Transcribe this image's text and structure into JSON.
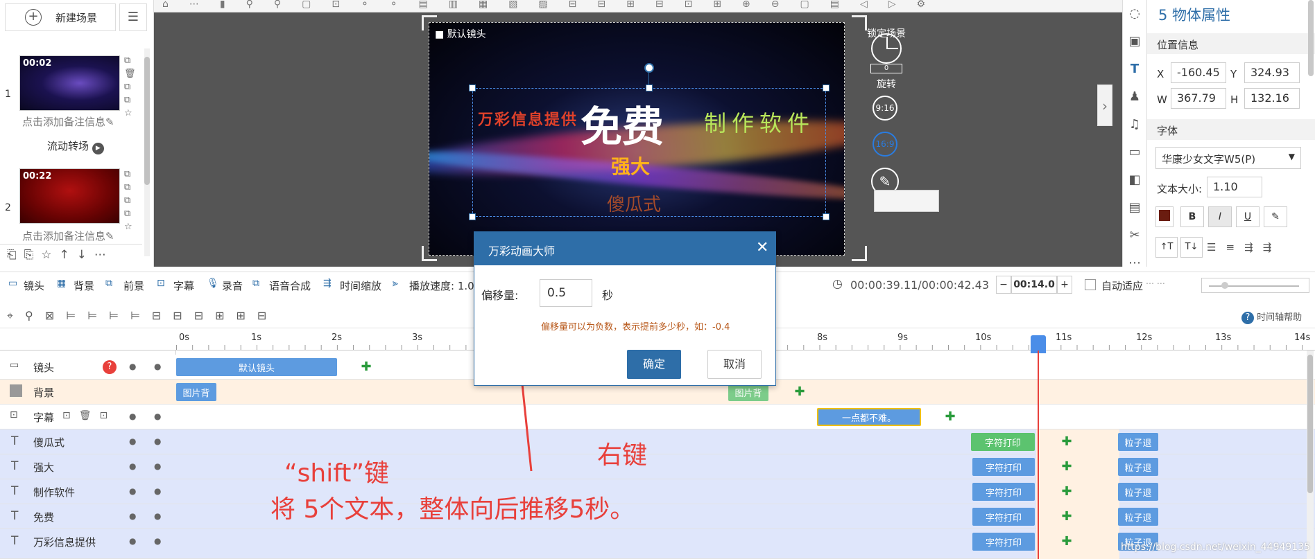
{
  "left_panel": {
    "new_scene_label": "新建场景",
    "scenes": [
      {
        "index": "1",
        "time": "00:02",
        "note": "点击添加备注信息",
        "transition": "流动转场"
      },
      {
        "index": "2",
        "time": "00:22",
        "note": "点击添加备注信息"
      }
    ]
  },
  "canvas": {
    "camera_label": "默认镜头",
    "text_free": "免费",
    "text_company": "万彩信息提供",
    "text_software": "制作软件",
    "text_strong": "强大",
    "text_sgs": "傻瓜式",
    "lock_scene": "锁定场景",
    "rotation_value": "0",
    "rotation_label": "旋转",
    "ratio_916": "9:16",
    "ratio_169": "16:9"
  },
  "props": {
    "title": "5 物体属性",
    "position_section": "位置信息",
    "x_label": "X",
    "x_value": "-160.45",
    "y_label": "Y",
    "y_value": "324.93",
    "w_label": "W",
    "w_value": "367.79",
    "h_label": "H",
    "h_value": "132.16",
    "font_section": "字体",
    "font_name": "华康少女文字W5(P)",
    "size_label": "文本大小:",
    "size_value": "1.10",
    "bold": "B",
    "italic": "I",
    "underline": "U",
    "text_grow": "↑T",
    "text_shrink": "T↓"
  },
  "toolbar": {
    "items": [
      "镜头",
      "背景",
      "前景",
      "字幕",
      "录音",
      "语音合成",
      "时间缩放",
      "播放速度: 1.00"
    ],
    "timecode": "00:00:39.11/00:00:42.43",
    "duration": "00:14.0",
    "auto_fit": "自动适应",
    "timeline_help": "时间轴帮助"
  },
  "timeline": {
    "ruler": [
      "0s",
      "1s",
      "2s",
      "3s",
      "8s",
      "9s",
      "10s",
      "11s",
      "12s",
      "13s",
      "14s"
    ],
    "tracks": [
      {
        "label": "镜头"
      },
      {
        "label": "背景"
      },
      {
        "label": "字幕"
      },
      {
        "label": "傻瓜式"
      },
      {
        "label": "强大"
      },
      {
        "label": "制作软件"
      },
      {
        "label": "免费"
      },
      {
        "label": "万彩信息提供"
      }
    ],
    "blocks": {
      "camera": "默认镜头",
      "bg1": "图片背",
      "bg2": "图片背",
      "subtitle": "一点都不难。",
      "typewriter": "字符打印",
      "particle": "粒子退"
    }
  },
  "dialog": {
    "title": "万彩动画大师",
    "offset_label": "偏移量:",
    "offset_value": "0.5",
    "unit": "秒",
    "hint": "偏移量可以为负数，表示提前多少秒，如：-0.4",
    "ok": "确定",
    "cancel": "取消"
  },
  "annotations": {
    "right_click": "右键",
    "shift_key": "“shift”键",
    "instruction": "将 5个文本，整体向后推移5秒。"
  },
  "watermark": "https://blog.csdn.net/weixin_44949135",
  "colors": {
    "accent": "#2e6ea8",
    "annotation": "#e8403b",
    "track_blue": "#dfe6fb",
    "track_bg": "#fff1e2",
    "playhead": "#e8403b"
  }
}
